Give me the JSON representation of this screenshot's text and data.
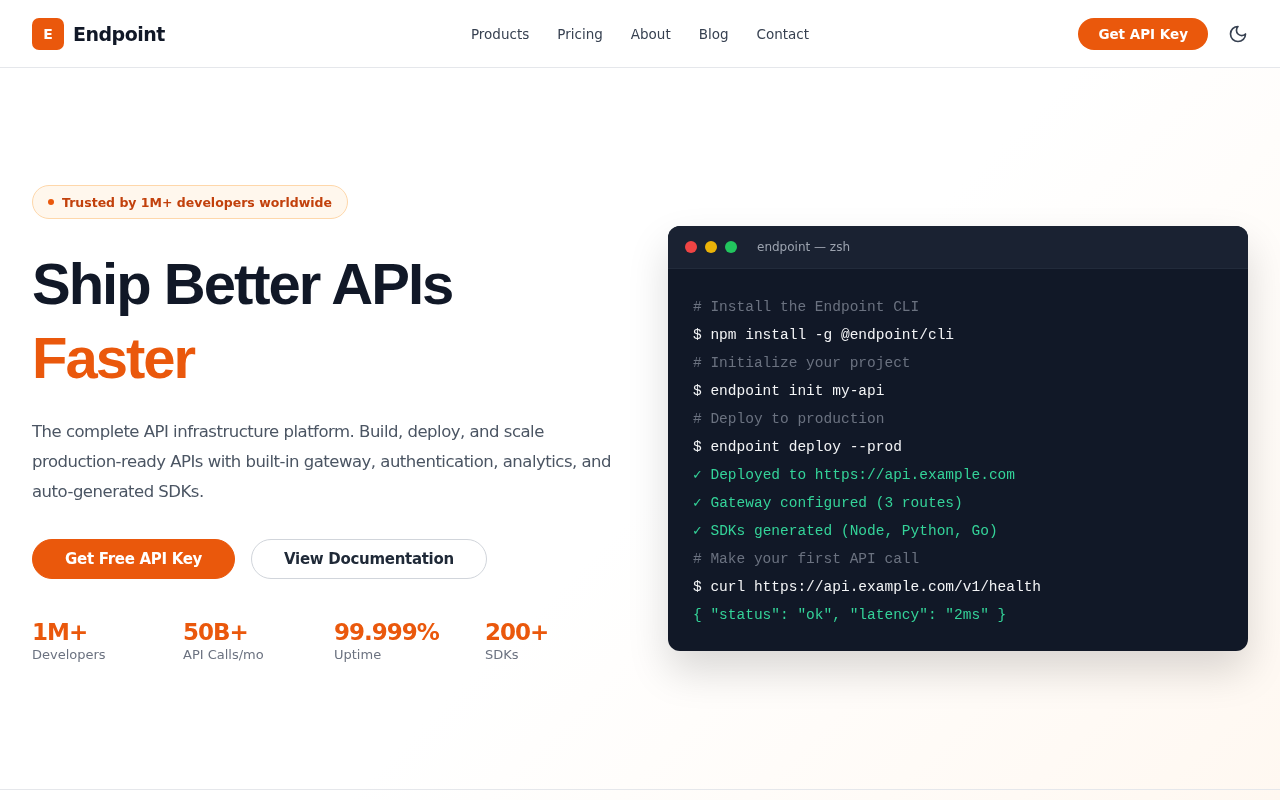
{
  "header": {
    "logo_letter": "E",
    "brand": "Endpoint",
    "nav": [
      {
        "label": "Products"
      },
      {
        "label": "Pricing"
      },
      {
        "label": "About"
      },
      {
        "label": "Blog"
      },
      {
        "label": "Contact"
      }
    ],
    "cta": "Get API Key"
  },
  "hero": {
    "badge": "Trusted by 1M+ developers worldwide",
    "title_line_1": "Ship Better APIs",
    "title_line_2": "Faster",
    "description": "The complete API infrastructure platform. Build, deploy, and scale production-ready APIs with built-in gateway, authentication, analytics, and auto-generated SDKs.",
    "buttons": [
      {
        "label": "Get Free API Key",
        "kind": "primary"
      },
      {
        "label": "View Documentation",
        "kind": "secondary"
      }
    ],
    "stats": [
      {
        "value": "1M+",
        "label": "Developers"
      },
      {
        "value": "50B+",
        "label": "API Calls/mo"
      },
      {
        "value": "99.999%",
        "label": "Uptime"
      },
      {
        "value": "200+",
        "label": "SDKs"
      }
    ]
  },
  "terminal": {
    "title": "endpoint — zsh",
    "dots": [
      {
        "color": "#ef4444"
      },
      {
        "color": "#eab308"
      },
      {
        "color": "#22c55e"
      }
    ],
    "lines": [
      {
        "kind": "comment",
        "text": "# Install the Endpoint CLI"
      },
      {
        "kind": "command",
        "text": "$ npm install -g @endpoint/cli"
      },
      {
        "kind": "comment",
        "text": "# Initialize your project"
      },
      {
        "kind": "command",
        "text": "$ endpoint init my-api"
      },
      {
        "kind": "comment",
        "text": "# Deploy to production"
      },
      {
        "kind": "command",
        "text": "$ endpoint deploy --prod"
      },
      {
        "kind": "output",
        "text": "✓ Deployed to https://api.example.com"
      },
      {
        "kind": "output",
        "text": "✓ Gateway configured (3 routes)"
      },
      {
        "kind": "output",
        "text": "✓ SDKs generated (Node, Python, Go)"
      },
      {
        "kind": "comment",
        "text": "# Make your first API call"
      },
      {
        "kind": "command",
        "text": "$ curl https://api.example.com/v1/health"
      },
      {
        "kind": "output",
        "text": "{ \"status\": \"ok\", \"latency\": \"2ms\" }"
      }
    ]
  }
}
